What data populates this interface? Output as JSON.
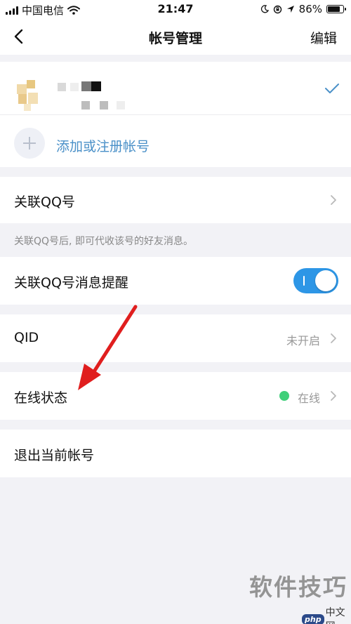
{
  "status_bar": {
    "carrier": "中国电信",
    "time": "21:47",
    "battery": "86%",
    "battery_level": 0.86
  },
  "nav": {
    "title": "帐号管理",
    "edit_label": "编辑",
    "back_icon": "chevron-left-icon"
  },
  "account": {
    "check_icon": "checkmark-icon",
    "add_label": "添加或注册帐号",
    "accent_color": "#4a90c8"
  },
  "settings": {
    "link_qq": {
      "label": "关联QQ号"
    },
    "link_qq_hint": "关联QQ号后, 即可代收该号的好友消息。",
    "qq_reminder": {
      "label": "关联QQ号消息提醒",
      "enabled": true,
      "toggle_color": "#2d96e6"
    },
    "qid": {
      "label": "QID",
      "value": "未开启"
    },
    "online_status": {
      "label": "在线状态",
      "value": "在线",
      "dot_color": "#3fcf79"
    },
    "logout": {
      "label": "退出当前帐号"
    }
  },
  "watermark": {
    "text": "软件技巧",
    "logo_php": "php",
    "logo_cn": "中文网"
  }
}
